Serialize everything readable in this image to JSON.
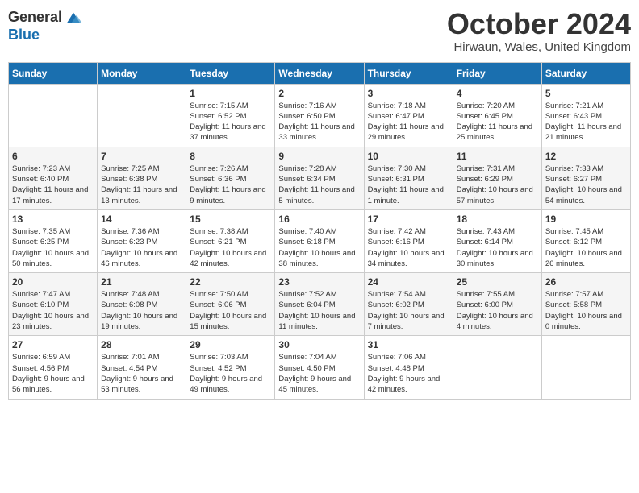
{
  "header": {
    "logo_general": "General",
    "logo_blue": "Blue",
    "month": "October 2024",
    "location": "Hirwaun, Wales, United Kingdom"
  },
  "weekdays": [
    "Sunday",
    "Monday",
    "Tuesday",
    "Wednesday",
    "Thursday",
    "Friday",
    "Saturday"
  ],
  "weeks": [
    [
      {
        "day": "",
        "info": ""
      },
      {
        "day": "",
        "info": ""
      },
      {
        "day": "1",
        "info": "Sunrise: 7:15 AM\nSunset: 6:52 PM\nDaylight: 11 hours and 37 minutes."
      },
      {
        "day": "2",
        "info": "Sunrise: 7:16 AM\nSunset: 6:50 PM\nDaylight: 11 hours and 33 minutes."
      },
      {
        "day": "3",
        "info": "Sunrise: 7:18 AM\nSunset: 6:47 PM\nDaylight: 11 hours and 29 minutes."
      },
      {
        "day": "4",
        "info": "Sunrise: 7:20 AM\nSunset: 6:45 PM\nDaylight: 11 hours and 25 minutes."
      },
      {
        "day": "5",
        "info": "Sunrise: 7:21 AM\nSunset: 6:43 PM\nDaylight: 11 hours and 21 minutes."
      }
    ],
    [
      {
        "day": "6",
        "info": "Sunrise: 7:23 AM\nSunset: 6:40 PM\nDaylight: 11 hours and 17 minutes."
      },
      {
        "day": "7",
        "info": "Sunrise: 7:25 AM\nSunset: 6:38 PM\nDaylight: 11 hours and 13 minutes."
      },
      {
        "day": "8",
        "info": "Sunrise: 7:26 AM\nSunset: 6:36 PM\nDaylight: 11 hours and 9 minutes."
      },
      {
        "day": "9",
        "info": "Sunrise: 7:28 AM\nSunset: 6:34 PM\nDaylight: 11 hours and 5 minutes."
      },
      {
        "day": "10",
        "info": "Sunrise: 7:30 AM\nSunset: 6:31 PM\nDaylight: 11 hours and 1 minute."
      },
      {
        "day": "11",
        "info": "Sunrise: 7:31 AM\nSunset: 6:29 PM\nDaylight: 10 hours and 57 minutes."
      },
      {
        "day": "12",
        "info": "Sunrise: 7:33 AM\nSunset: 6:27 PM\nDaylight: 10 hours and 54 minutes."
      }
    ],
    [
      {
        "day": "13",
        "info": "Sunrise: 7:35 AM\nSunset: 6:25 PM\nDaylight: 10 hours and 50 minutes."
      },
      {
        "day": "14",
        "info": "Sunrise: 7:36 AM\nSunset: 6:23 PM\nDaylight: 10 hours and 46 minutes."
      },
      {
        "day": "15",
        "info": "Sunrise: 7:38 AM\nSunset: 6:21 PM\nDaylight: 10 hours and 42 minutes."
      },
      {
        "day": "16",
        "info": "Sunrise: 7:40 AM\nSunset: 6:18 PM\nDaylight: 10 hours and 38 minutes."
      },
      {
        "day": "17",
        "info": "Sunrise: 7:42 AM\nSunset: 6:16 PM\nDaylight: 10 hours and 34 minutes."
      },
      {
        "day": "18",
        "info": "Sunrise: 7:43 AM\nSunset: 6:14 PM\nDaylight: 10 hours and 30 minutes."
      },
      {
        "day": "19",
        "info": "Sunrise: 7:45 AM\nSunset: 6:12 PM\nDaylight: 10 hours and 26 minutes."
      }
    ],
    [
      {
        "day": "20",
        "info": "Sunrise: 7:47 AM\nSunset: 6:10 PM\nDaylight: 10 hours and 23 minutes."
      },
      {
        "day": "21",
        "info": "Sunrise: 7:48 AM\nSunset: 6:08 PM\nDaylight: 10 hours and 19 minutes."
      },
      {
        "day": "22",
        "info": "Sunrise: 7:50 AM\nSunset: 6:06 PM\nDaylight: 10 hours and 15 minutes."
      },
      {
        "day": "23",
        "info": "Sunrise: 7:52 AM\nSunset: 6:04 PM\nDaylight: 10 hours and 11 minutes."
      },
      {
        "day": "24",
        "info": "Sunrise: 7:54 AM\nSunset: 6:02 PM\nDaylight: 10 hours and 7 minutes."
      },
      {
        "day": "25",
        "info": "Sunrise: 7:55 AM\nSunset: 6:00 PM\nDaylight: 10 hours and 4 minutes."
      },
      {
        "day": "26",
        "info": "Sunrise: 7:57 AM\nSunset: 5:58 PM\nDaylight: 10 hours and 0 minutes."
      }
    ],
    [
      {
        "day": "27",
        "info": "Sunrise: 6:59 AM\nSunset: 4:56 PM\nDaylight: 9 hours and 56 minutes."
      },
      {
        "day": "28",
        "info": "Sunrise: 7:01 AM\nSunset: 4:54 PM\nDaylight: 9 hours and 53 minutes."
      },
      {
        "day": "29",
        "info": "Sunrise: 7:03 AM\nSunset: 4:52 PM\nDaylight: 9 hours and 49 minutes."
      },
      {
        "day": "30",
        "info": "Sunrise: 7:04 AM\nSunset: 4:50 PM\nDaylight: 9 hours and 45 minutes."
      },
      {
        "day": "31",
        "info": "Sunrise: 7:06 AM\nSunset: 4:48 PM\nDaylight: 9 hours and 42 minutes."
      },
      {
        "day": "",
        "info": ""
      },
      {
        "day": "",
        "info": ""
      }
    ]
  ]
}
